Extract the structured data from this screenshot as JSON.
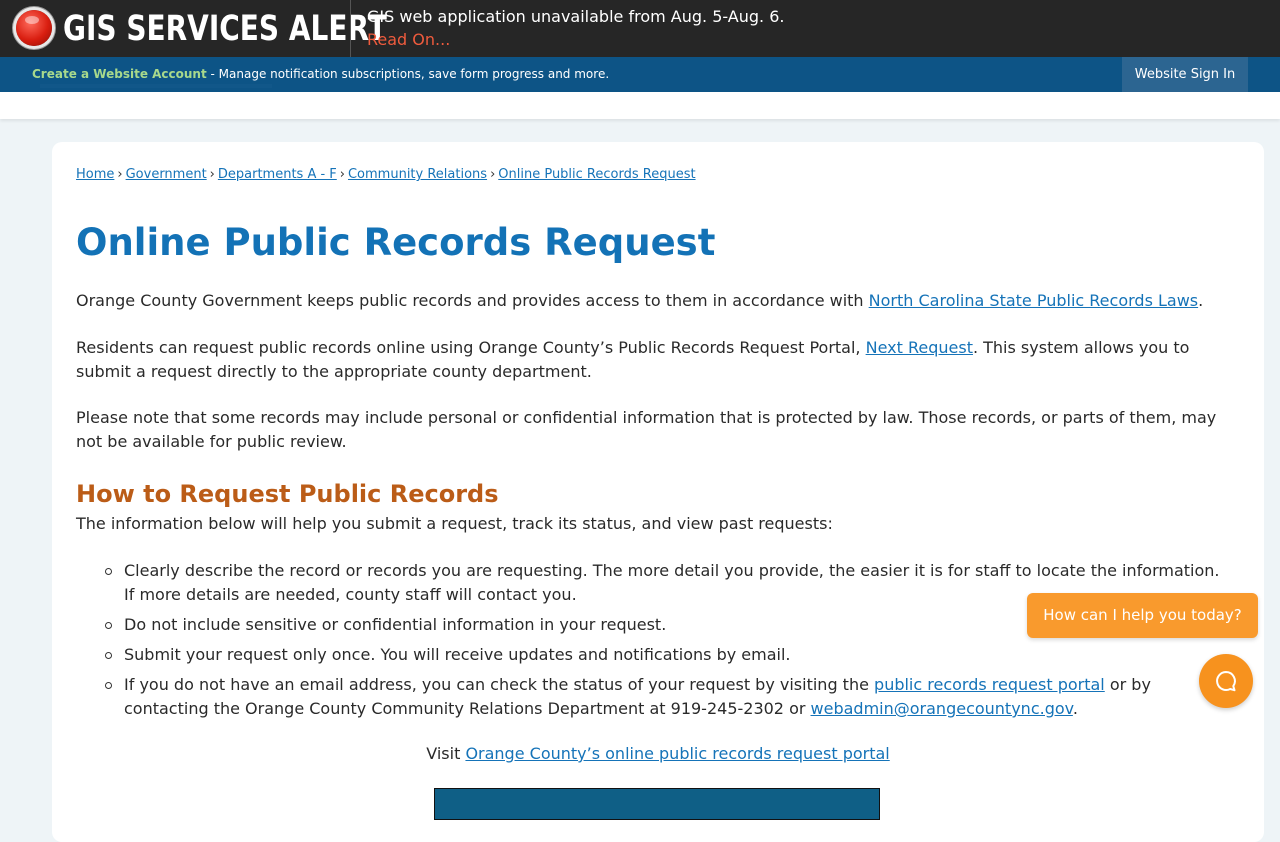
{
  "alert": {
    "title": "GIS SERVICES ALERT",
    "message": "GIS web application unavailable from Aug. 5-Aug. 6.",
    "link": "Read On...",
    "icon": "alert-red-circle-icon"
  },
  "account_bar": {
    "create_link": "Create a Website Account",
    "description": " - Manage notification subscriptions, save form progress and more.",
    "sign_in": "Website Sign In"
  },
  "breadcrumb": [
    "Home",
    "Government",
    "Departments A - F",
    "Community Relations",
    "Online Public Records Request"
  ],
  "breadcrumb_separator": "›",
  "page": {
    "title": "Online Public Records Request",
    "p1_text": "Orange County Government keeps public records and provides access to them in accordance with ",
    "p1_link": "North Carolina State Public Records Laws",
    "p1_end": ".",
    "p2_text": "Residents can request public records online using Orange County’s Public Records Request Portal, ",
    "p2_link": "Next Request",
    "p2_end": ". This system allows you to submit a request directly to the appropriate county department.",
    "p3_text": "Please note that some records may include personal or confidential information that is protected by law. Those records, or parts of them, may not be available for public review.",
    "section_title": "How to Request Public Records",
    "section_intro": "The information below will help you submit a request, track its status, and view past requests:",
    "bullets": {
      "b1": "Clearly describe the record or records you are requesting. The more detail you provide, the easier it is for staff to locate the information. If more details are needed, county staff will contact you.",
      "b2": "Do not include sensitive or confidential information in your request.",
      "b3": "Submit your request only once. You will receive updates and notifications by email.",
      "b4_text": "If you do not have an email address, you can check the status of your request by visiting the ",
      "b4_link": "public records request portal",
      "b4_mid": " or by contacting the Orange County Community Relations Department at 919-245-2302 or ",
      "b4_email": "webadmin@orangecountync.gov",
      "b4_end": "."
    },
    "visit_text": "Visit ",
    "visit_link": "Orange County’s online public records request portal"
  },
  "chat": {
    "prompt": "How can I help you today?",
    "icon": "chat-bubble-icon"
  },
  "colors": {
    "alert_bg": "#262626",
    "alert_link": "#ef5b3d",
    "account_bar_bg": "#0d5486",
    "title_blue": "#1372b6",
    "section_orange": "#bb5c17",
    "link_blue": "#1573b8",
    "chat_orange": "#f99a2d"
  }
}
